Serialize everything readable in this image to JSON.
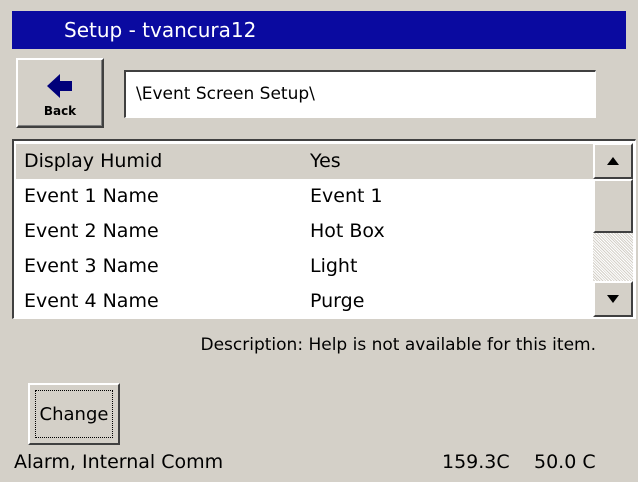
{
  "window": {
    "title": "Setup - tvancura12"
  },
  "toolbar": {
    "back_label": "Back",
    "back_icon": "arrow-left-icon",
    "path": "\\Event Screen Setup\\"
  },
  "settings_list": {
    "items": [
      {
        "name": "Display Humid",
        "value": "Yes",
        "selected": true
      },
      {
        "name": "Event 1 Name",
        "value": "Event 1",
        "selected": false
      },
      {
        "name": "Event 2 Name",
        "value": "Hot Box",
        "selected": false
      },
      {
        "name": "Event 3 Name",
        "value": "Light",
        "selected": false
      },
      {
        "name": "Event 4 Name",
        "value": "Purge",
        "selected": false
      }
    ],
    "scroll_up_icon": "triangle-up-icon",
    "scroll_down_icon": "triangle-down-icon"
  },
  "description": "Description:  Help is not available for this item.",
  "actions": {
    "change_label": "Change"
  },
  "status_bar": {
    "alarm": "Alarm, Internal Comm",
    "temperature": "159.3C",
    "humidity": "50.0 C"
  },
  "colors": {
    "title_bar": "#0a0aa0",
    "background": "#d4d0c8",
    "selected_row": "#d4d0c8"
  }
}
